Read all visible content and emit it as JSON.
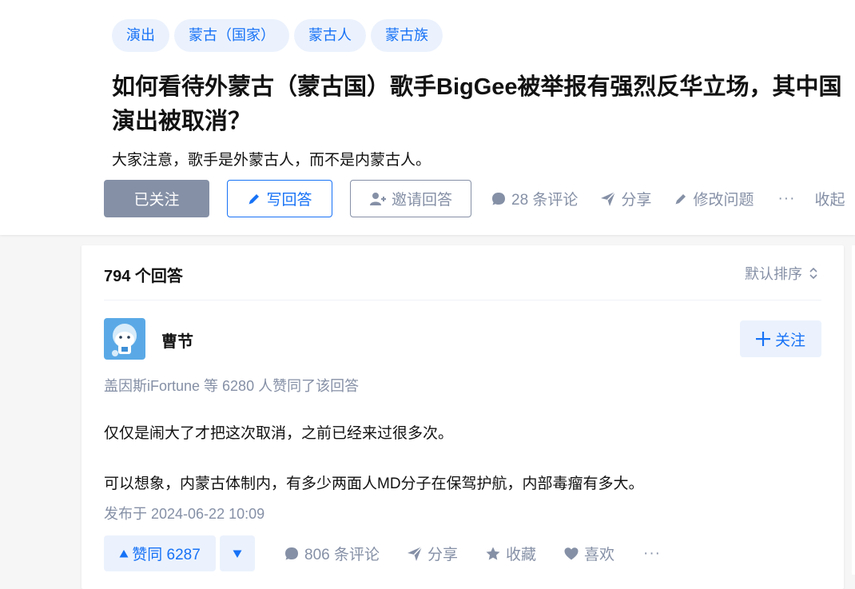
{
  "question": {
    "topics": [
      "演出",
      "蒙古（国家）",
      "蒙古人",
      "蒙古族"
    ],
    "title": "如何看待外蒙古（蒙古国）歌手BigGee被举报有强烈反华立场，其中国演出被取消？",
    "detail": "大家注意，歌手是外蒙古人，而不是内蒙古人。",
    "followed_label": "已关注",
    "write_answer_label": "写回答",
    "invite_label": "邀请回答",
    "comments_label": "28 条评论",
    "share_label": "分享",
    "edit_label": "修改问题",
    "more_label": "···",
    "collapse_label": "收起"
  },
  "answer_list": {
    "count_label": "794 个回答",
    "sort_label": "默认排序"
  },
  "answer": {
    "author_name": "曹节",
    "follow_label": "关注",
    "voters_text": "盖因斯iFortune 等 6280 人赞同了该回答",
    "paragraphs": [
      "仅仅是闹大了才把这次取消，之前已经来过很多次。",
      "可以想象，内蒙古体制内，有多少两面人MD分子在保驾护航，内部毒瘤有多大。"
    ],
    "publish_time": "发布于 2024-06-22 10:09",
    "upvote_label": "赞同 6287",
    "comments_label": "806 条评论",
    "share_label": "分享",
    "collect_label": "收藏",
    "like_label": "喜欢",
    "more_label": "···"
  },
  "colors": {
    "brand_blue": "#1772f6",
    "tag_bg": "#ebf2fd",
    "muted_gray": "#8590a6",
    "text_dark": "#121212",
    "page_bg": "#f6f6f6"
  },
  "icons": {
    "write": "pencil-icon",
    "invite": "add-user-icon",
    "comment": "comment-bubble-icon",
    "share": "paper-plane-icon",
    "edit": "pencil-icon",
    "sort": "up-down-chevron-icon",
    "follow": "plus-icon",
    "upvote": "triangle-up-icon",
    "downvote": "triangle-down-icon",
    "collect": "star-icon",
    "like": "heart-icon"
  }
}
